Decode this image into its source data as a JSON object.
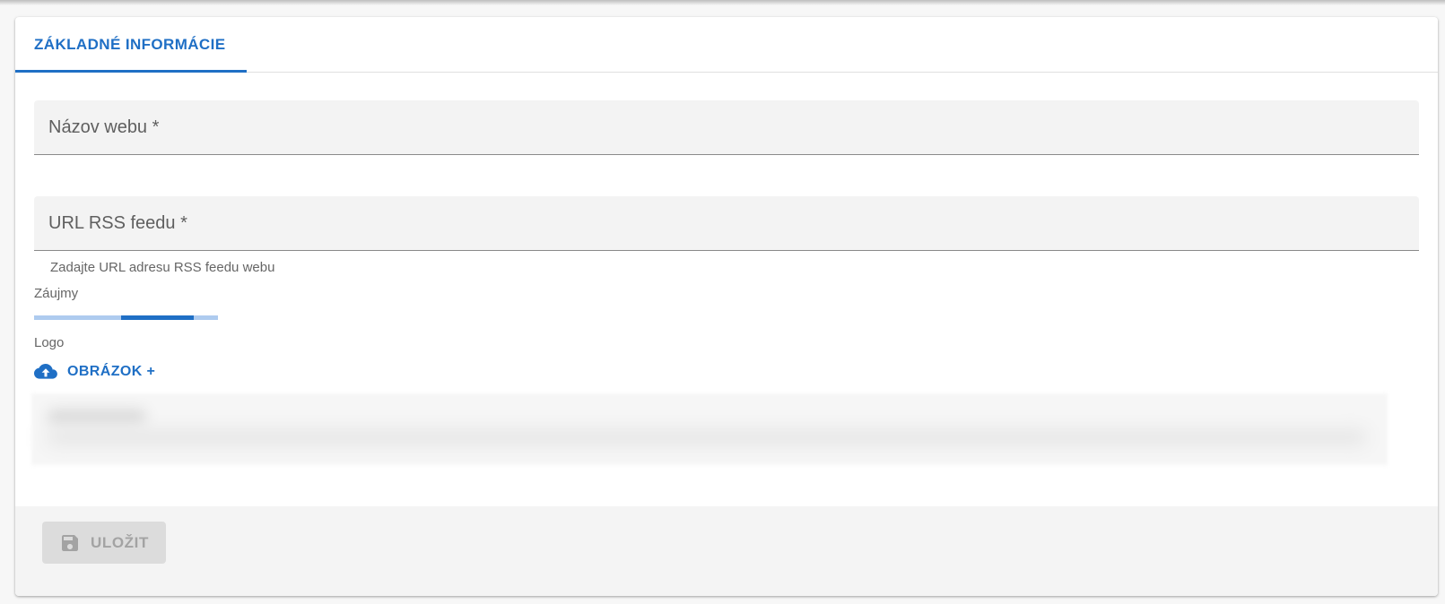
{
  "tabs": [
    {
      "label": "ZÁKLADNÉ INFORMÁCIE",
      "active": true
    }
  ],
  "form": {
    "site_name": {
      "label": "Názov webu *",
      "value": ""
    },
    "rss_url": {
      "label": "URL RSS feedu *",
      "value": "",
      "helper": "Zadajte URL adresu RSS feedu webu"
    },
    "interests": {
      "label": "Záujmy",
      "loading_indicator": {
        "state": "indeterminate"
      }
    },
    "logo": {
      "label": "Logo",
      "upload_button": {
        "label": "OBRÁZOK +",
        "icon": "cloud-upload-icon"
      }
    }
  },
  "footer": {
    "save_button": {
      "label": "ULOŽIT",
      "icon": "save-icon",
      "disabled": true
    }
  },
  "colors": {
    "accent": "#1f6fc5",
    "accent_light": "#aecbef",
    "field_bg": "#f3f3f3",
    "disabled_bg": "#dcdcdc",
    "disabled_text": "#a3a3a3"
  }
}
